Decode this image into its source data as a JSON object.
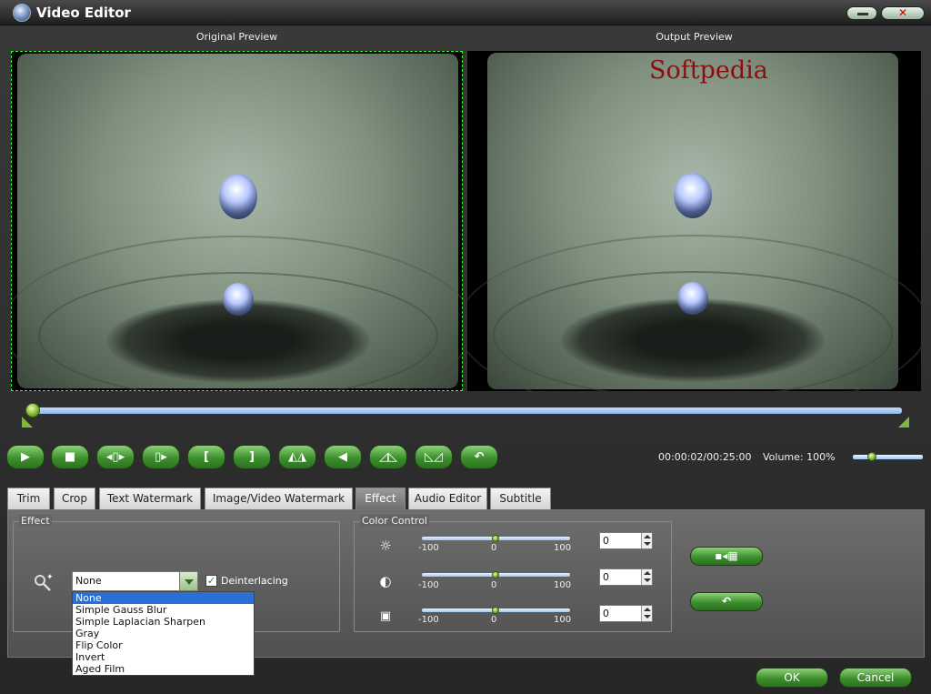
{
  "window": {
    "title": "Video Editor"
  },
  "preview": {
    "original_label": "Original Preview",
    "output_label": "Output Preview",
    "watermark_text": "Softpedia"
  },
  "playback": {
    "time": "00:00:02/00:25:00",
    "volume_label": "Volume:",
    "volume_value": "100%",
    "timeline_position": 0.0
  },
  "tabs": [
    {
      "label": "Trim"
    },
    {
      "label": "Crop"
    },
    {
      "label": "Text Watermark"
    },
    {
      "label": "Image/Video Watermark"
    },
    {
      "label": "Effect"
    },
    {
      "label": "Audio Editor"
    },
    {
      "label": "Subtitle"
    }
  ],
  "active_tab": "Effect",
  "effect": {
    "group_label": "Effect",
    "selected": "None",
    "deinterlacing_label": "Deinterlacing",
    "deinterlacing_checked": true,
    "options": [
      "None",
      "Simple Gauss Blur",
      "Simple Laplacian Sharpen",
      "Gray",
      "Flip Color",
      "Invert",
      "Aged Film"
    ]
  },
  "color_control": {
    "group_label": "Color Control",
    "sliders": [
      {
        "icon": "brightness-icon",
        "min": "-100",
        "mid": "0",
        "max": "100",
        "value": "0"
      },
      {
        "icon": "contrast-icon",
        "min": "-100",
        "mid": "0",
        "max": "100",
        "value": "0"
      },
      {
        "icon": "saturation-icon",
        "min": "-100",
        "mid": "0",
        "max": "100",
        "value": "0"
      }
    ]
  },
  "buttons": {
    "ok": "OK",
    "cancel": "Cancel"
  },
  "colors": {
    "accent_green": "#3c8f2c",
    "timeline_blue": "#8fb7e8",
    "watermark_red": "#8a0e0e",
    "selection_blue": "#2a6fd6"
  }
}
